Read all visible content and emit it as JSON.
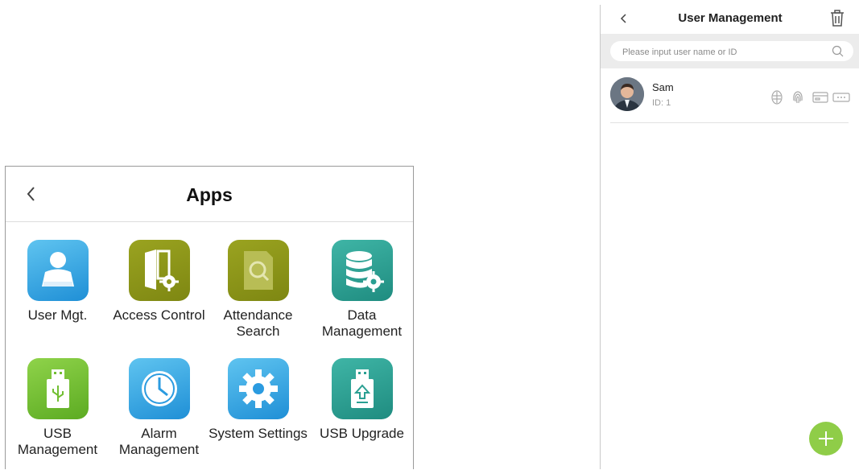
{
  "apps_screen": {
    "title": "Apps",
    "apps": [
      {
        "label": "User Mgt.",
        "icon": "user-icon",
        "color": "#2b9be0"
      },
      {
        "label": "Access Control",
        "icon": "door-gear-icon",
        "color": "#8c9418"
      },
      {
        "label": "Attendance\nSearch",
        "icon": "document-search-icon",
        "color": "#8c9418"
      },
      {
        "label": "Data\nManagement",
        "icon": "database-gear-icon",
        "color": "#2a9f92"
      },
      {
        "label": "USB\nManagement",
        "icon": "usb-drive-icon",
        "color": "#72bf33"
      },
      {
        "label": "Alarm\nManagement",
        "icon": "clock-icon",
        "color": "#2b9be0"
      },
      {
        "label": "System Settings",
        "icon": "gear-icon",
        "color": "#2b9be0"
      },
      {
        "label": "USB Upgrade",
        "icon": "usb-upgrade-icon",
        "color": "#2a9f92"
      }
    ]
  },
  "user_management": {
    "title": "User Management",
    "search": {
      "placeholder": "Please input user name or ID",
      "value": ""
    },
    "users": [
      {
        "name": "Sam",
        "id": "ID: 1",
        "credentials": [
          "face-icon",
          "fingerprint-icon",
          "card-icon",
          "password-icon"
        ]
      }
    ],
    "fab_color": "#8fcd48"
  }
}
